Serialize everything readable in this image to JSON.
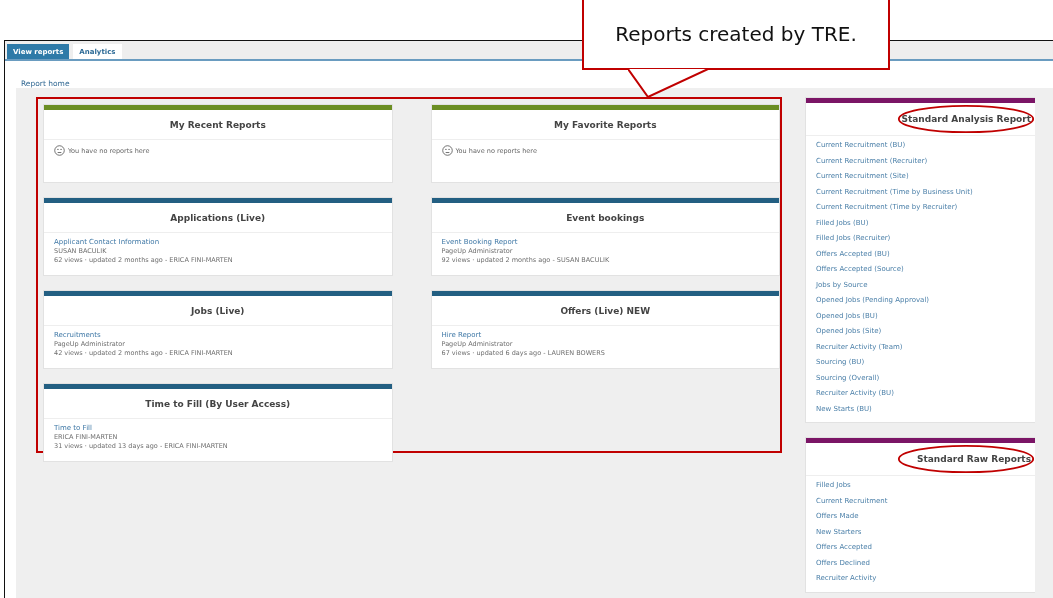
{
  "callout": {
    "text": "Reports created by TRE."
  },
  "tabs": [
    {
      "label": "View reports",
      "selected": true
    },
    {
      "label": "Analytics",
      "selected": false
    }
  ],
  "breadcrumb": "Report home",
  "highlighted_group": {
    "columns": [
      [
        {
          "kind": "empty",
          "title": "My Recent Reports",
          "color": "#6b8e23",
          "empty_message": "You have no reports here"
        },
        {
          "kind": "reports",
          "title": "Applications (Live)",
          "color": "#235f82",
          "reports": [
            {
              "name": "Applicant Contact Information",
              "owner": "SUSAN BACULIK",
              "meta": "62 views · updated 2 months ago - ERICA FINI-MARTEN"
            }
          ]
        },
        {
          "kind": "reports",
          "title": "Jobs (Live)",
          "color": "#235f82",
          "reports": [
            {
              "name": "Recruitments",
              "owner": "PageUp Administrator",
              "meta": "42 views · updated 2 months ago - ERICA FINI-MARTEN"
            }
          ]
        },
        {
          "kind": "reports",
          "title": "Time to Fill (By User Access)",
          "color": "#235f82",
          "reports": [
            {
              "name": "Time to Fill",
              "owner": "ERICA FINI-MARTEN",
              "meta": "31 views · updated 13 days ago - ERICA FINI-MARTEN"
            }
          ]
        }
      ],
      [
        {
          "kind": "empty",
          "title": "My Favorite Reports",
          "color": "#6b8e23",
          "empty_message": "You have no reports here"
        },
        {
          "kind": "reports",
          "title": "Event bookings",
          "color": "#235f82",
          "reports": [
            {
              "name": "Event Booking Report",
              "owner": "PageUp Administrator",
              "meta": "92 views · updated 2 months ago - SUSAN BACULIK"
            }
          ]
        },
        {
          "kind": "reports",
          "title": "Offers (Live) NEW",
          "color": "#235f82",
          "reports": [
            {
              "name": "Hire Report",
              "owner": "PageUp Administrator",
              "meta": "67 views · updated 6 days ago - LAUREN BOWERS"
            }
          ]
        }
      ]
    ]
  },
  "sidebar": [
    {
      "title": "Standard Analysis Report",
      "color": "#7b1566",
      "circled": true,
      "links": [
        "Current Recruitment (BU)",
        "Current Recruitment (Recruiter)",
        "Current Recruitment (Site)",
        "Current Recruitment (Time by Business Unit)",
        "Current Recruitment (Time by Recruiter)",
        "Filled Jobs (BU)",
        "Filled Jobs (Recruiter)",
        "Offers Accepted (BU)",
        "Offers Accepted (Source)",
        "Jobs by Source",
        "Opened Jobs (Pending Approval)",
        "Opened Jobs (BU)",
        "Opened Jobs (Site)",
        "Recruiter Activity (Team)",
        "Sourcing (BU)",
        "Sourcing (Overall)",
        "Recruiter Activity (BU)",
        "New Starts (BU)"
      ]
    },
    {
      "title": "Standard Raw Reports",
      "color": "#7b1566",
      "circled": true,
      "links": [
        "Filled Jobs",
        "Current Recruitment",
        "Offers Made",
        "New Starters",
        "Offers Accepted",
        "Offers Declined",
        "Recruiter Activity"
      ]
    }
  ]
}
